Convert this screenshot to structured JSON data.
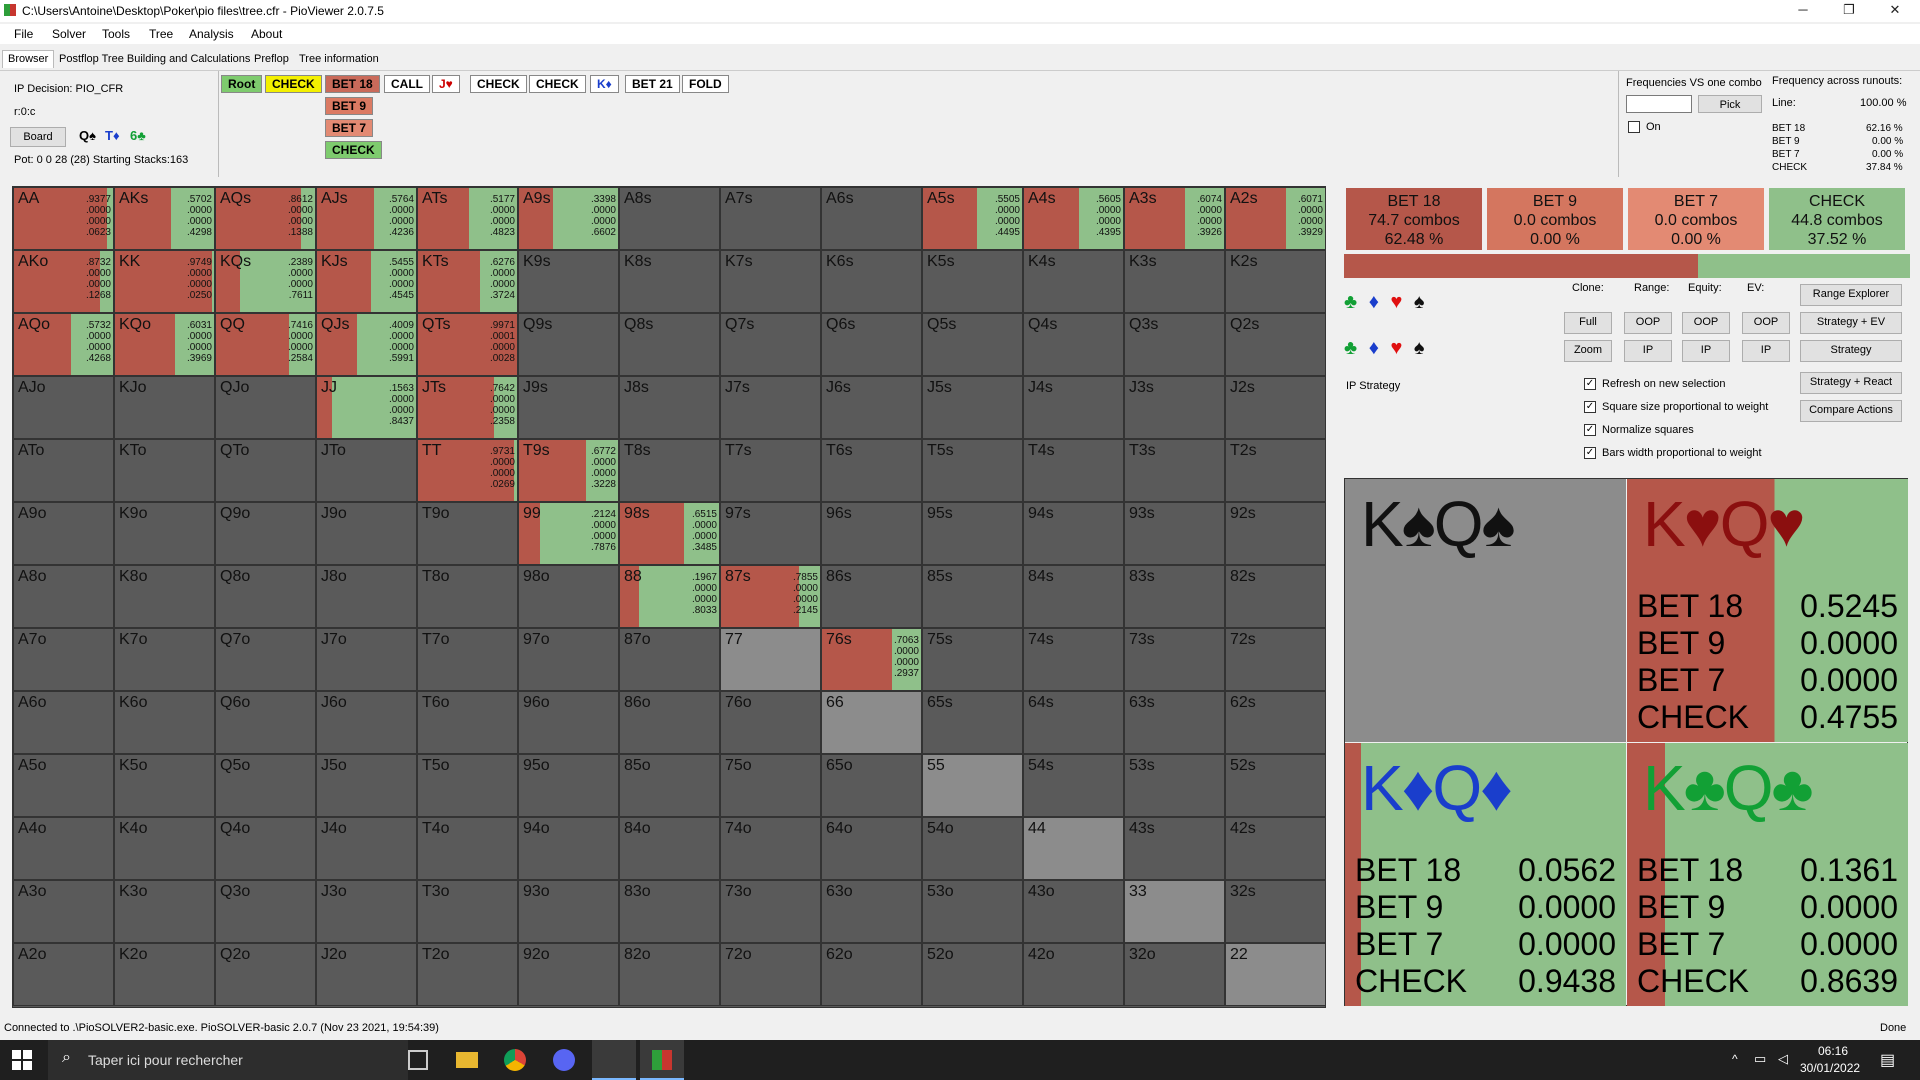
{
  "window": {
    "title": "C:\\Users\\Antoine\\Desktop\\Poker\\pio files\\tree.cfr - PioViewer 2.0.7.5"
  },
  "menu": [
    "File",
    "Solver",
    "Tools",
    "Tree",
    "Analysis",
    "About"
  ],
  "tabs": [
    "Browser",
    "Postflop Tree Building and Calculations",
    "Preflop",
    "Tree information"
  ],
  "info": {
    "decision": "IP Decision:  PIO_CFR",
    "node": "r:0:c",
    "board_button": "Board",
    "board_cards": [
      "Q♠",
      "T♦",
      "6♣"
    ],
    "pot": "Pot: 0 0 28 (28) Starting Stacks:163"
  },
  "breadcrumb": [
    "Root",
    "CHECK",
    "BET 18",
    "CALL",
    "J♥",
    "CHECK",
    "CHECK",
    "K♦",
    "BET 21",
    "FOLD"
  ],
  "actions_sub": [
    "BET 9",
    "BET 7",
    "CHECK"
  ],
  "freq": {
    "label": "Frequencies VS one combo",
    "pick": "Pick",
    "on": "On",
    "runouts_title": "Frequency across runouts:",
    "line_label": "Line:",
    "line_value": "100.00 %",
    "rows": [
      [
        "BET 18",
        "62.16 %"
      ],
      [
        "BET 9",
        "0.00 %"
      ],
      [
        "BET 7",
        "0.00 %"
      ],
      [
        "CHECK",
        "37.84 %"
      ]
    ]
  },
  "action_boxes": [
    {
      "name": "BET 18",
      "combos": "74.7 combos",
      "pct": "62.48 %",
      "color": "#b5574a"
    },
    {
      "name": "BET 9",
      "combos": "0.0 combos",
      "pct": "0.00 %",
      "color": "#d4765f"
    },
    {
      "name": "BET 7",
      "combos": "0.0 combos",
      "pct": "0.00 %",
      "color": "#e38a73"
    },
    {
      "name": "CHECK",
      "combos": "44.8 combos",
      "pct": "37.52 %",
      "color": "#8fc08a"
    }
  ],
  "aggregate_bar": {
    "bet_fraction": 0.6248
  },
  "controls": {
    "clone": "Clone:",
    "range": "Range:",
    "equity": "Equity:",
    "ev": "EV:",
    "full": "Full",
    "zoom": "Zoom",
    "oop": "OOP",
    "ip": "IP",
    "range_explorer": "Range Explorer",
    "strategy_ev": "Strategy + EV",
    "strategy": "Strategy",
    "strategy_react": "Strategy + React",
    "compare": "Compare Actions",
    "ip_strategy": "IP Strategy",
    "checks": [
      "Refresh on new selection",
      "Square size proportional to weight",
      "Normalize squares",
      "Bars width proportional to weight"
    ]
  },
  "suits": [
    "♣",
    "♦",
    "♥",
    "♠"
  ],
  "combo_detail": [
    {
      "hand": "K♠Q♠",
      "color": "#111",
      "bg": "grey",
      "vals": []
    },
    {
      "hand": "K♥Q♥",
      "color": "#8b0f0f",
      "bg": "red",
      "vals": [
        [
          "BET 18",
          "0.5245"
        ],
        [
          "BET 9",
          "0.0000"
        ],
        [
          "BET 7",
          "0.0000"
        ],
        [
          "CHECK",
          "0.4755"
        ]
      ],
      "bet": 0.5245
    },
    {
      "hand": "K♦Q♦",
      "color": "#1a3ecc",
      "bg": "green",
      "vals": [
        [
          "BET 18",
          "0.0562"
        ],
        [
          "BET 9",
          "0.0000"
        ],
        [
          "BET 7",
          "0.0000"
        ],
        [
          "CHECK",
          "0.9438"
        ]
      ],
      "bet": 0.0562
    },
    {
      "hand": "K♣Q♣",
      "color": "#12a035",
      "bg": "green",
      "vals": [
        [
          "BET 18",
          "0.1361"
        ],
        [
          "BET 9",
          "0.0000"
        ],
        [
          "BET 7",
          "0.0000"
        ],
        [
          "CHECK",
          "0.8639"
        ]
      ],
      "bet": 0.1361
    }
  ],
  "grid": [
    [
      [
        "AA",
        [
          0.9377,
          0,
          0,
          0.0623
        ]
      ],
      [
        "AKs",
        [
          0.5702,
          0,
          0,
          0.4298
        ]
      ],
      [
        "AQs",
        [
          0.8612,
          0,
          0,
          0.1388
        ]
      ],
      [
        "AJs",
        [
          0.5764,
          0,
          0,
          0.4236
        ]
      ],
      [
        "ATs",
        [
          0.5177,
          0,
          0,
          0.4823
        ]
      ],
      [
        "A9s",
        [
          0.3398,
          0,
          0,
          0.6602
        ]
      ],
      [
        "A8s",
        null
      ],
      [
        "A7s",
        null
      ],
      [
        "A6s",
        null
      ],
      [
        "A5s",
        [
          0.5505,
          0,
          0,
          0.4495
        ]
      ],
      [
        "A4s",
        [
          0.5605,
          0,
          0,
          0.4395
        ]
      ],
      [
        "A3s",
        [
          0.6074,
          0,
          0,
          0.3926
        ]
      ],
      [
        "A2s",
        [
          0.6071,
          0,
          0,
          0.3929
        ]
      ]
    ],
    [
      [
        "AKo",
        [
          0.8732,
          0,
          0,
          0.1268
        ]
      ],
      [
        "KK",
        [
          0.9749,
          0,
          0,
          0.025
        ]
      ],
      [
        "KQs",
        [
          0.2389,
          0,
          0,
          0.7611
        ]
      ],
      [
        "KJs",
        [
          0.5455,
          0,
          0,
          0.4545
        ]
      ],
      [
        "KTs",
        [
          0.6276,
          0,
          0,
          0.3724
        ]
      ],
      [
        "K9s",
        null
      ],
      [
        "K8s",
        null
      ],
      [
        "K7s",
        null
      ],
      [
        "K6s",
        null
      ],
      [
        "K5s",
        null
      ],
      [
        "K4s",
        null
      ],
      [
        "K3s",
        null
      ],
      [
        "K2s",
        null
      ]
    ],
    [
      [
        "AQo",
        [
          0.5732,
          0,
          0,
          0.4268
        ]
      ],
      [
        "KQo",
        [
          0.6031,
          0,
          0,
          0.3969
        ]
      ],
      [
        "QQ",
        [
          0.7416,
          0,
          0,
          0.2584
        ]
      ],
      [
        "QJs",
        [
          0.4009,
          0,
          0,
          0.5991
        ]
      ],
      [
        "QTs",
        [
          0.9971,
          0.0001,
          0,
          0.0028
        ]
      ],
      [
        "Q9s",
        null
      ],
      [
        "Q8s",
        null
      ],
      [
        "Q7s",
        null
      ],
      [
        "Q6s",
        null
      ],
      [
        "Q5s",
        null
      ],
      [
        "Q4s",
        null
      ],
      [
        "Q3s",
        null
      ],
      [
        "Q2s",
        null
      ]
    ],
    [
      [
        "AJo",
        null
      ],
      [
        "KJo",
        null
      ],
      [
        "QJo",
        null
      ],
      [
        "JJ",
        [
          0.1563,
          0,
          0,
          0.8437
        ]
      ],
      [
        "JTs",
        [
          0.7642,
          0,
          0,
          0.2358
        ]
      ],
      [
        "J9s",
        null
      ],
      [
        "J8s",
        null
      ],
      [
        "J7s",
        null
      ],
      [
        "J6s",
        null
      ],
      [
        "J5s",
        null
      ],
      [
        "J4s",
        null
      ],
      [
        "J3s",
        null
      ],
      [
        "J2s",
        null
      ]
    ],
    [
      [
        "ATo",
        null
      ],
      [
        "KTo",
        null
      ],
      [
        "QTo",
        null
      ],
      [
        "JTo",
        null
      ],
      [
        "TT",
        [
          0.9731,
          0,
          0,
          0.0269
        ]
      ],
      [
        "T9s",
        [
          0.6772,
          0,
          0,
          0.3228
        ]
      ],
      [
        "T8s",
        null
      ],
      [
        "T7s",
        null
      ],
      [
        "T6s",
        null
      ],
      [
        "T5s",
        null
      ],
      [
        "T4s",
        null
      ],
      [
        "T3s",
        null
      ],
      [
        "T2s",
        null
      ]
    ],
    [
      [
        "A9o",
        null
      ],
      [
        "K9o",
        null
      ],
      [
        "Q9o",
        null
      ],
      [
        "J9o",
        null
      ],
      [
        "T9o",
        null
      ],
      [
        "99",
        [
          0.2124,
          0,
          0,
          0.7876
        ]
      ],
      [
        "98s",
        [
          0.6515,
          0,
          0,
          0.3485
        ]
      ],
      [
        "97s",
        null
      ],
      [
        "96s",
        null
      ],
      [
        "95s",
        null
      ],
      [
        "94s",
        null
      ],
      [
        "93s",
        null
      ],
      [
        "92s",
        null
      ]
    ],
    [
      [
        "A8o",
        null
      ],
      [
        "K8o",
        null
      ],
      [
        "Q8o",
        null
      ],
      [
        "J8o",
        null
      ],
      [
        "T8o",
        null
      ],
      [
        "98o",
        null
      ],
      [
        "88",
        [
          0.1967,
          0,
          0,
          0.8033
        ]
      ],
      [
        "87s",
        [
          0.7855,
          0,
          0,
          0.2145
        ]
      ],
      [
        "86s",
        null
      ],
      [
        "85s",
        null
      ],
      [
        "84s",
        null
      ],
      [
        "83s",
        null
      ],
      [
        "82s",
        null
      ]
    ],
    [
      [
        "A7o",
        null
      ],
      [
        "K7o",
        null
      ],
      [
        "Q7o",
        null
      ],
      [
        "J7o",
        null
      ],
      [
        "T7o",
        null
      ],
      [
        "97o",
        null
      ],
      [
        "87o",
        null
      ],
      [
        "77",
        null
      ],
      [
        "76s",
        [
          0.7063,
          0,
          0,
          0.2937
        ]
      ],
      [
        "75s",
        null
      ],
      [
        "74s",
        null
      ],
      [
        "73s",
        null
      ],
      [
        "72s",
        null
      ]
    ],
    [
      [
        "A6o",
        null
      ],
      [
        "K6o",
        null
      ],
      [
        "Q6o",
        null
      ],
      [
        "J6o",
        null
      ],
      [
        "T6o",
        null
      ],
      [
        "96o",
        null
      ],
      [
        "86o",
        null
      ],
      [
        "76o",
        null
      ],
      [
        "66",
        null
      ],
      [
        "65s",
        null
      ],
      [
        "64s",
        null
      ],
      [
        "63s",
        null
      ],
      [
        "62s",
        null
      ]
    ],
    [
      [
        "A5o",
        null
      ],
      [
        "K5o",
        null
      ],
      [
        "Q5o",
        null
      ],
      [
        "J5o",
        null
      ],
      [
        "T5o",
        null
      ],
      [
        "95o",
        null
      ],
      [
        "85o",
        null
      ],
      [
        "75o",
        null
      ],
      [
        "65o",
        null
      ],
      [
        "55",
        null
      ],
      [
        "54s",
        null
      ],
      [
        "53s",
        null
      ],
      [
        "52s",
        null
      ]
    ],
    [
      [
        "A4o",
        null
      ],
      [
        "K4o",
        null
      ],
      [
        "Q4o",
        null
      ],
      [
        "J4o",
        null
      ],
      [
        "T4o",
        null
      ],
      [
        "94o",
        null
      ],
      [
        "84o",
        null
      ],
      [
        "74o",
        null
      ],
      [
        "64o",
        null
      ],
      [
        "54o",
        null
      ],
      [
        "44",
        null
      ],
      [
        "43s",
        null
      ],
      [
        "42s",
        null
      ]
    ],
    [
      [
        "A3o",
        null
      ],
      [
        "K3o",
        null
      ],
      [
        "Q3o",
        null
      ],
      [
        "J3o",
        null
      ],
      [
        "T3o",
        null
      ],
      [
        "93o",
        null
      ],
      [
        "83o",
        null
      ],
      [
        "73o",
        null
      ],
      [
        "63o",
        null
      ],
      [
        "53o",
        null
      ],
      [
        "43o",
        null
      ],
      [
        "33",
        null
      ],
      [
        "32s",
        null
      ]
    ],
    [
      [
        "A2o",
        null
      ],
      [
        "K2o",
        null
      ],
      [
        "Q2o",
        null
      ],
      [
        "J2o",
        null
      ],
      [
        "T2o",
        null
      ],
      [
        "92o",
        null
      ],
      [
        "82o",
        null
      ],
      [
        "72o",
        null
      ],
      [
        "62o",
        null
      ],
      [
        "52o",
        null
      ],
      [
        "42o",
        null
      ],
      [
        "32o",
        null
      ],
      [
        "22",
        null
      ]
    ]
  ],
  "status": {
    "left": "Connected to .\\PioSOLVER2-basic.exe. PioSOLVER-basic 2.0.7 (Nov 23 2021, 19:54:39)",
    "right": "Done"
  },
  "taskbar": {
    "search": "Taper ici pour rechercher",
    "time": "06:16",
    "date": "30/01/2022"
  },
  "colors": {
    "bet": "#b5574a",
    "check": "#8fc08a",
    "empty": "#5a5a5a"
  }
}
